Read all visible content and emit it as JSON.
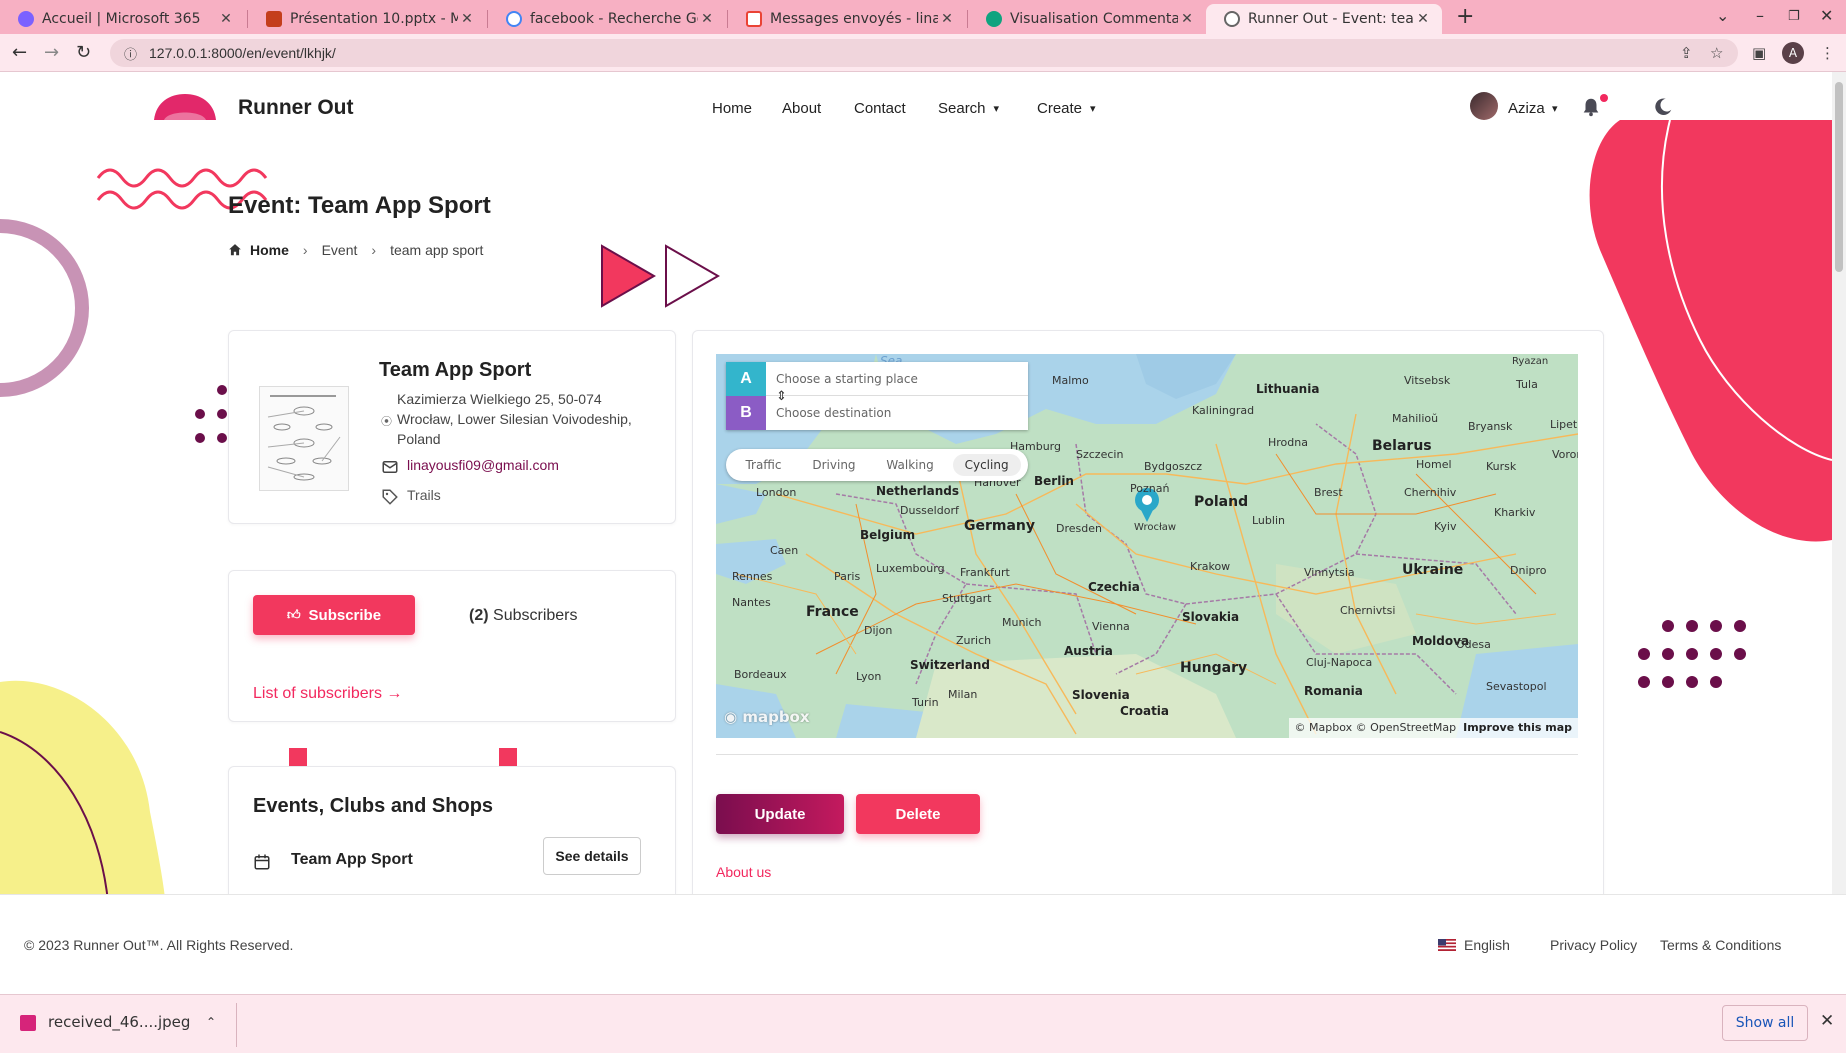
{
  "browser": {
    "tabs": [
      {
        "title": "Accueil | Microsoft 365",
        "favicon": "microsoft365-icon",
        "color": "#7b61ff"
      },
      {
        "title": "Présentation 10.pptx - Mi",
        "favicon": "powerpoint-icon",
        "color": "#c43e1c"
      },
      {
        "title": "facebook - Recherche Goo",
        "favicon": "google-icon",
        "color": "#4285f4"
      },
      {
        "title": "Messages envoyés - linayo",
        "favicon": "gmail-icon",
        "color": "#ea4335"
      },
      {
        "title": "Visualisation Commentai",
        "favicon": "chatgpt-icon",
        "color": "#10a37f"
      },
      {
        "title": "Runner Out - Event: team",
        "favicon": "globe-icon",
        "color": "#666666"
      }
    ],
    "url": "127.0.0.1:8000/en/event/lkhjk/"
  },
  "header": {
    "brand": "Runner Out",
    "nav": [
      "Home",
      "About",
      "Contact",
      "Search",
      "Create"
    ],
    "user_name": "Aziza"
  },
  "page": {
    "title": "Event: Team App Sport",
    "breadcrumb": [
      "Home",
      "Event",
      "team app sport"
    ]
  },
  "event": {
    "name": "Team App Sport",
    "address": "Kazimierza Wielkiego 25, 50-074 Wrocław, Lower Silesian Voivodeship, Poland",
    "email": "linayousfi09@gmail.com",
    "tag": "Trails"
  },
  "subscribe": {
    "button": "Subscribe",
    "count": "(2)",
    "count_label": "Subscribers",
    "list_link": "List of subscribers →"
  },
  "related": {
    "title": "Events, Clubs and Shops",
    "item": "Team App Sport",
    "details_button": "See details"
  },
  "map": {
    "start_placeholder": "Choose a starting place",
    "dest_placeholder": "Choose destination",
    "badge_a": "A",
    "badge_b": "B",
    "modes": [
      "Traffic",
      "Driving",
      "Walking",
      "Cycling"
    ],
    "selected_mode": "Cycling",
    "logo": "mapbox",
    "attribution": "© Mapbox © OpenStreetMap",
    "improve": "Improve this map",
    "labels": {
      "lithuania": "Lithuania",
      "belarus": "Belarus",
      "poland": "Poland",
      "germany": "Germany",
      "netherlands": "Netherlands",
      "belgium": "Belgium",
      "france": "France",
      "czechia": "Czechia",
      "slovakia": "Slovakia",
      "austria": "Austria",
      "hungary": "Hungary",
      "ukraine": "Ukraine",
      "switzerland": "Switzerland",
      "moldova": "Moldova",
      "romania": "Romania",
      "slovenia": "Slovenia",
      "croatia": "Croatia",
      "luxembourg": "Luxembourg",
      "london": "London",
      "paris": "Paris",
      "berlin": "Berlin",
      "hamburg": "Hamburg",
      "hanover": "Hanover",
      "dresden": "Dresden",
      "frankfurt": "Frankfurt",
      "dusseldorf": "Dusseldorf",
      "stuttgart": "Stuttgart",
      "munich": "Munich",
      "zurich": "Zurich",
      "vienna": "Vienna",
      "krakow": "Krakow",
      "lublin": "Lublin",
      "brest": "Brest",
      "kyiv": "Kyiv",
      "kharkiv": "Kharkiv",
      "dnipro": "Dnipro",
      "vinnytsia": "Vinnytsia",
      "chernivtsi": "Chernivtsi",
      "odesa": "Odesa",
      "cluj": "Cluj-Napoca",
      "sevastopol": "Sevastopol",
      "bordeaux": "Bordeaux",
      "lyon": "Lyon",
      "milan": "Milan",
      "turin": "Turin",
      "rennes": "Rennes",
      "nantes": "Nantes",
      "caen": "Caen",
      "dijon": "Dijon",
      "szczecin": "Szczecin",
      "poznan": "Poznań",
      "bydgoszcz": "Bydgoszcz",
      "kaliningrad": "Kaliningrad",
      "hrodna": "Hrodna",
      "vitsebsk": "Vitsebsk",
      "mahilou": "Mahilioŭ",
      "homel": "Homel",
      "kursk": "Kursk",
      "bryansk": "Bryansk",
      "tula": "Tula",
      "ryazan": "Ryazan",
      "chernihiv": "Chernihiv",
      "malmo": "Malmo",
      "wroclaw": "Wrocław",
      "sea": "Sea",
      "voron": "Voron",
      "lipet": "Lipet"
    }
  },
  "actions": {
    "update": "Update",
    "delete": "Delete",
    "about": "About us"
  },
  "footer": {
    "copyright": "© 2023 Runner Out™. All Rights Reserved.",
    "language": "English",
    "privacy": "Privacy Policy",
    "terms": "Terms & Conditions"
  },
  "downloads": {
    "file": "received_46....jpeg",
    "show_all": "Show all"
  },
  "colors": {
    "accent": "#f2385e",
    "brand_dark": "#7a0d4e",
    "tabbar": "#f7b0c3"
  }
}
